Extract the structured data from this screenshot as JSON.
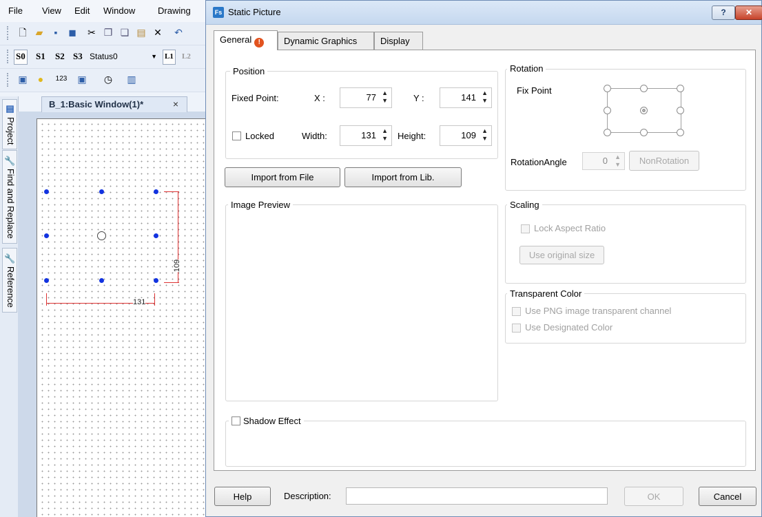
{
  "menu": {
    "file": "File",
    "view": "View",
    "edit": "Edit",
    "window": "Window",
    "drawing": "Drawing"
  },
  "toolbar": {
    "status_buttons": [
      "S0",
      "S1",
      "S2",
      "S3"
    ],
    "status_select": "Status0",
    "layer_buttons": [
      "L1",
      "L2"
    ]
  },
  "sidebar": {
    "tabs": [
      "Project",
      "Find and Replace",
      "Reference"
    ]
  },
  "document_tab": {
    "label": "B_1:Basic Window(1)*",
    "close": "×"
  },
  "canvas": {
    "width_dim": "131",
    "height_dim": "109"
  },
  "dialog": {
    "title": "Static Picture",
    "title_icon": "Fs",
    "help_glyph": "?",
    "close_glyph": "✕",
    "tabs": [
      {
        "label": "General",
        "warning": "!"
      },
      {
        "label": "Dynamic Graphics"
      },
      {
        "label": "Display"
      }
    ],
    "position": {
      "title": "Position",
      "fixed_point_label": "Fixed Point:",
      "x_label": "X :",
      "x_value": "77",
      "y_label": "Y :",
      "y_value": "141",
      "locked_label": "Locked",
      "locked_checked": false,
      "width_label": "Width:",
      "width_value": "131",
      "height_label": "Height:",
      "height_value": "109"
    },
    "import_file_label": "Import from File",
    "import_lib_label": "Import from Lib.",
    "image_preview_title": "Image Preview",
    "rotation": {
      "title": "Rotation",
      "fix_point_label": "Fix Point",
      "angle_label": "RotationAngle",
      "angle_value": "0",
      "non_rotation_label": "NonRotation"
    },
    "scaling": {
      "title": "Scaling",
      "lock_aspect_label": "Lock Aspect Ratio",
      "use_original_label": "Use original size"
    },
    "transparent": {
      "title": "Transparent Color",
      "png_channel_label": "Use PNG image transparent channel",
      "designated_label": "Use Designated Color"
    },
    "shadow": {
      "label": "Shadow Effect"
    },
    "footer": {
      "help_label": "Help",
      "description_label": "Description:",
      "description_value": "",
      "ok_label": "OK",
      "cancel_label": "Cancel"
    }
  }
}
